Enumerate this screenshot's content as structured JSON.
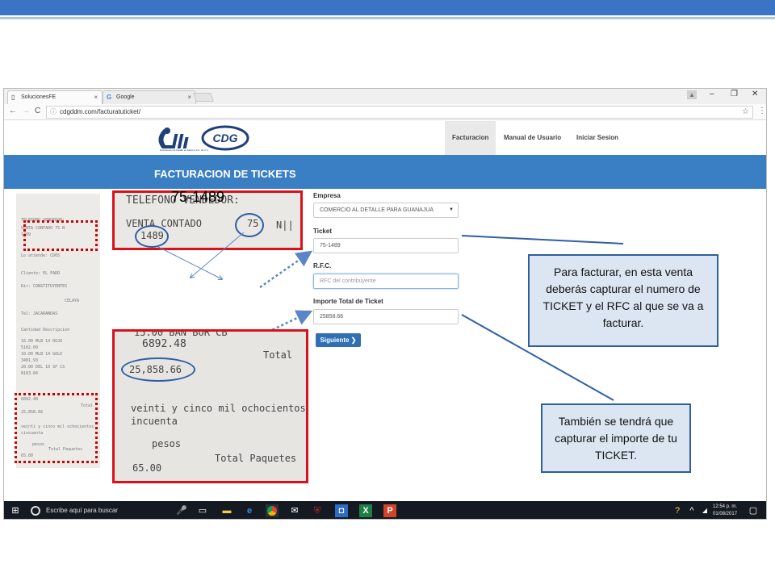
{
  "browser": {
    "tabs": [
      {
        "label": "SolucionesFE",
        "close": "×"
      },
      {
        "label": "Google",
        "close": "×"
      }
    ],
    "window_controls": {
      "minimize": "–",
      "maximize": "❐",
      "close": "✕"
    },
    "url": "cdgddm.com/facturatuticket/"
  },
  "site": {
    "logo_text": "CDG",
    "logo_tagline": "Distribución al Detalle en México S.A. de C.V.",
    "nav": [
      "Facturacion",
      "Manual de Usuario",
      "Iniciar Sesion"
    ],
    "banner_title": "FACTURACION DE TICKETS"
  },
  "form": {
    "empresa": {
      "label": "Empresa",
      "value": "COMERCIO AL DETALLE PARA GUANAJUA"
    },
    "ticket": {
      "label": "Ticket",
      "value": "75-1489"
    },
    "rfc": {
      "label": "R.F.C.",
      "placeholder": "RFC del contribuyente"
    },
    "importe": {
      "label": "Importe Total de Ticket",
      "value": "25858.66"
    },
    "submit": "Siguiente ❯"
  },
  "receipt": {
    "zoom_top": {
      "line1": "TELEFONO VENDEDOR:",
      "line2": "VENTA CONTADO",
      "sale_no": "75",
      "ticket_no": "1489",
      "suffix": "N||"
    },
    "zoom_bottom": {
      "line0": "15.00 BAN BOR CB",
      "line1": "6892.48",
      "total_label": "Total",
      "total": "25,858.66",
      "words1": "veinti y cinco mil ochocientos c",
      "words2": "incuenta",
      "pesos": "pesos",
      "paquetes_label": "Total Paquetes",
      "paquetes": "65.00"
    },
    "combined": "75-1489",
    "thumb_lines": [
      "TELEFONO VENDEDOR:",
      "VENTA CONTADO  75  N",
      "1489",
      "Lo atiende: CD65",
      "Cliente: EL FARO",
      "Dir: CONSTITUYENTES",
      "CELAYA",
      "Tel:  JACARANDAS",
      "Cantidad  Descripcion",
      "16.00  MLB 14 ROJO",
      "5102.09",
      "10.00  MLB 14 GOLD",
      "3401.93",
      "20.00  DEL 10 SF CS",
      "8163.84",
      "6892.48",
      "Total",
      "25,858.66",
      "veinti y cinco mil ochocientos",
      "cincuenta",
      "pesos",
      "Total Paquetes",
      "65.00"
    ]
  },
  "taskbar": {
    "search": "Escribe aquí para buscar",
    "time": "12:54 p. m.",
    "date": "01/08/2017"
  },
  "callouts": {
    "ticket": "Para facturar, en esta venta deberás capturar el numero de TICKET y el RFC al que se va a facturar.",
    "importe": "También se tendrá que capturar el importe de tu TICKET."
  }
}
